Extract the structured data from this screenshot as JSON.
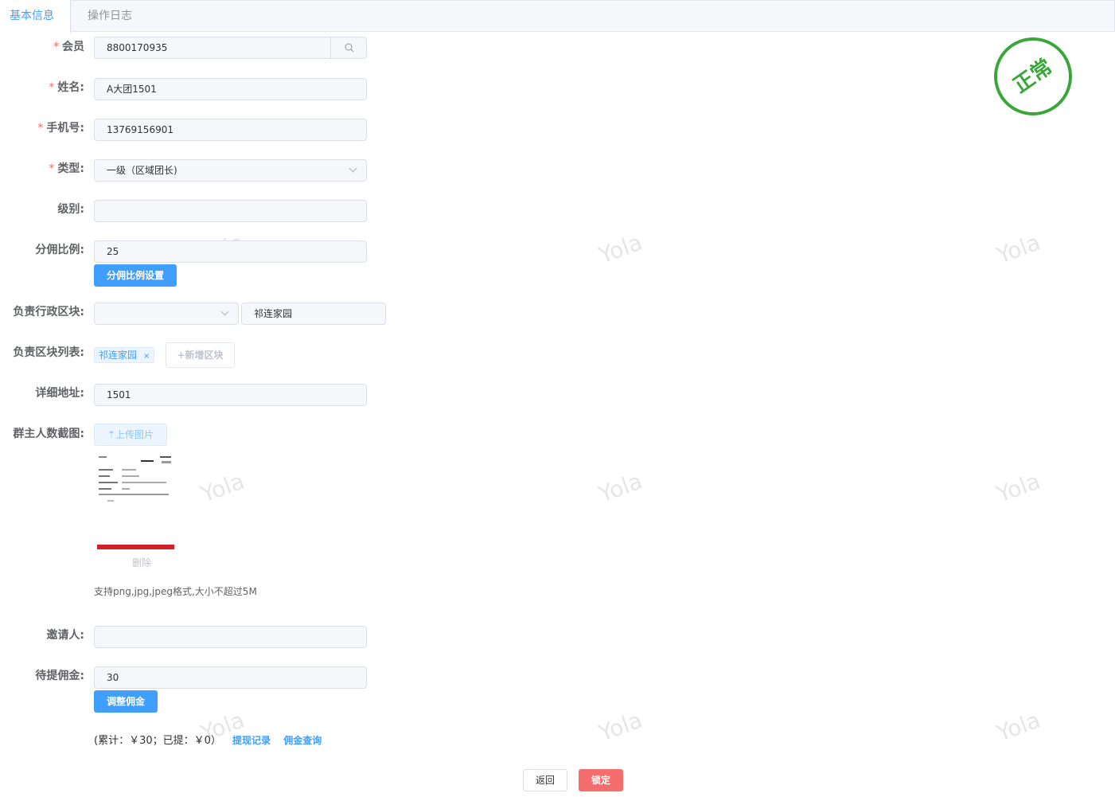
{
  "tabs": [
    {
      "label": "基本信息",
      "active": true
    },
    {
      "label": "操作日志",
      "active": false
    }
  ],
  "watermark": "Yola",
  "status_stamp": "正常",
  "form": {
    "member": {
      "label": "会员",
      "value": "8800170935"
    },
    "name": {
      "label": "姓名:",
      "value": "A大团1501"
    },
    "phone": {
      "label": "手机号:",
      "value": "13769156901"
    },
    "type": {
      "label": "类型:",
      "value": "一级（区域团长)"
    },
    "level": {
      "label": "级别:",
      "value": ""
    },
    "commission_ratio": {
      "label": "分佣比例:",
      "value": "25",
      "button": "分佣比例设置"
    },
    "admin_block": {
      "label": "负责行政区块:",
      "select_value": "",
      "block_value": "祁连家园"
    },
    "block_list": {
      "label": "负责区块列表:",
      "tags": [
        "祁连家园"
      ],
      "add_button": "+新增区块"
    },
    "address": {
      "label": "详细地址:",
      "value": "1501"
    },
    "group_screenshot": {
      "label": "群主人数截图:",
      "upload_button": "上传图片",
      "delete": "删除",
      "hint": "支持png,jpg,jpeg格式,大小不超过5M"
    },
    "inviter": {
      "label": "邀请人:",
      "value": ""
    },
    "pending_commission": {
      "label": "待提佣金:",
      "value": "30",
      "button": "调整佣金"
    },
    "summary": {
      "text": "(累计：￥30；已提：￥0）",
      "withdraw_link": "提现记录",
      "query_link": "佣金查询"
    }
  },
  "actions": {
    "back": "返回",
    "lock": "锁定"
  },
  "colors": {
    "primary": "#409eff",
    "danger": "#f56c6c",
    "stamp": "#3aa63a"
  }
}
